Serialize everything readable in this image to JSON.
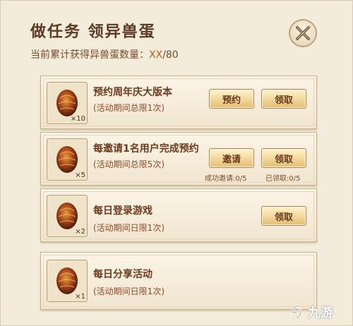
{
  "header": {
    "title": "做任务 领异兽蛋",
    "counter_label": "当前累计获得异兽蛋数量：",
    "counter_current": "XX",
    "counter_total": "/80"
  },
  "colors": {
    "accent": "#c4561d",
    "text_brown": "#6a3a1e",
    "panel_bg": "#f3ecdb"
  },
  "tasks": [
    {
      "name": "预约周年庆大版本",
      "limit": "(活动期间总限1次)",
      "qty": "×10",
      "action_label": "预约",
      "claim_label": "领取"
    },
    {
      "name": "每邀请1名用户完成预约",
      "limit": "(活动期间总限5次)",
      "qty": "×5",
      "action_label": "邀请",
      "claim_label": "领取",
      "invite_progress": "成功邀请:0/5",
      "claim_progress": "已领取:0/5"
    },
    {
      "name": "每日登录游戏",
      "limit": "(活动期间日限1次)",
      "qty": "×2",
      "claim_label": "领取"
    },
    {
      "name": "每日分享活动",
      "limit": "(活动期间日限1次)",
      "qty": "×1"
    }
  ],
  "watermark": {
    "text": "九游",
    "icon": "jiuyou-logo-icon"
  }
}
